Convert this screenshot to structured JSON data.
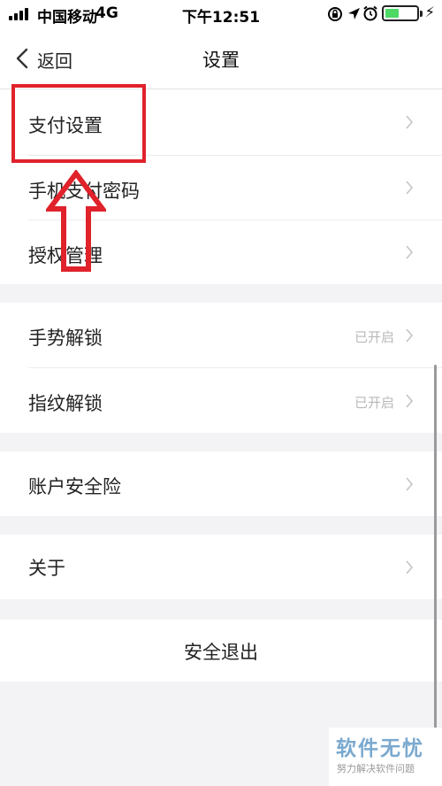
{
  "status_bar": {
    "carrier": "中国移动",
    "network": "4G",
    "time": "下午12:51",
    "battery_level": 0.45
  },
  "nav": {
    "back_label": "返回",
    "title": "设置"
  },
  "groups": [
    {
      "items": [
        {
          "label": "支付设置",
          "value": ""
        },
        {
          "label": "手机支付密码",
          "value": ""
        },
        {
          "label": "授权管理",
          "value": ""
        }
      ]
    },
    {
      "items": [
        {
          "label": "手势解锁",
          "value": "已开启"
        },
        {
          "label": "指纹解锁",
          "value": "已开启"
        }
      ]
    },
    {
      "items": [
        {
          "label": "账户安全险",
          "value": ""
        }
      ]
    },
    {
      "items": [
        {
          "label": "关于",
          "value": ""
        }
      ]
    }
  ],
  "logout_label": "安全退出",
  "watermark": {
    "title": "软件无忧",
    "subtitle": "努力解决软件问题"
  },
  "colors": {
    "annotation_red": "#e0222b",
    "battery_green": "#4cd964"
  }
}
